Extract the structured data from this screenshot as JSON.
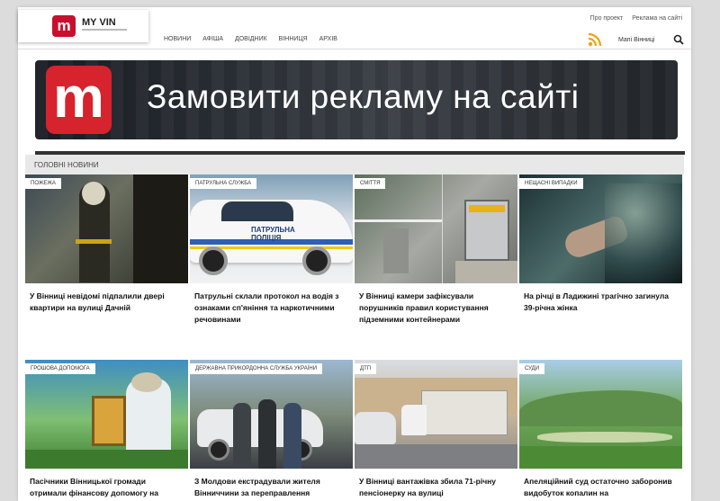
{
  "brand": {
    "logo_mark": "m",
    "name": "MY VIN"
  },
  "top_links": [
    "Про проект",
    "Реклама на сайті"
  ],
  "nav": {
    "items": [
      "НОВИНИ",
      "АФІША",
      "ДОВІДНИК",
      "ВІННИЦЯ",
      "АРХІВ"
    ],
    "right_link": "Мапі Вінниці"
  },
  "icons": {
    "rss": "rss-icon",
    "search": "search-icon"
  },
  "banner": {
    "logo_mark": "m",
    "text": "Замовити рекламу на сайті"
  },
  "section": {
    "title": "ГОЛОВНІ НОВИНИ"
  },
  "cards": [
    {
      "tag": "ПОЖЕЖА",
      "title": "У Вінниці невідомі підпалили двері квартири на вулиці Дачній"
    },
    {
      "tag": "ПАТРУЛЬНА СЛУЖБА",
      "title": "Патрульні склали протокол на водія з ознаками сп'яніння та наркотичними речовинами"
    },
    {
      "tag": "СМІТТЯ",
      "title": "У Вінниці камери зафіксували порушників правил користування підземними контейнерами"
    },
    {
      "tag": "НЕЩАСНІ ВИПАДКИ",
      "title": "На річці в Ладижині трагічно загинула 39-річна жінка"
    },
    {
      "tag": "ГРОШОВА ДОПОМОГА",
      "title": "Пасічники Вінницької громади отримали фінансову допомогу на"
    },
    {
      "tag": "ДЕРЖАВНА ПРИКОРДОННА СЛУЖБА УКРАЇНИ",
      "title": "З Молдови екстрадували жителя Вінниччини за переправлення"
    },
    {
      "tag": "ДТП",
      "title": "У Вінниці вантажівка збила 71-річну пенсіонерку на вулиці"
    },
    {
      "tag": "СУДИ",
      "title": "Апеляційний суд остаточно заборонив видобуток копалин на"
    }
  ],
  "police_car_label": "ПАТРУЛЬНА ПОЛІЦІЯ",
  "colors": {
    "brand_red": "#d6232d",
    "page_bg": "#dcdcdc",
    "rss_orange": "#f0a010"
  }
}
